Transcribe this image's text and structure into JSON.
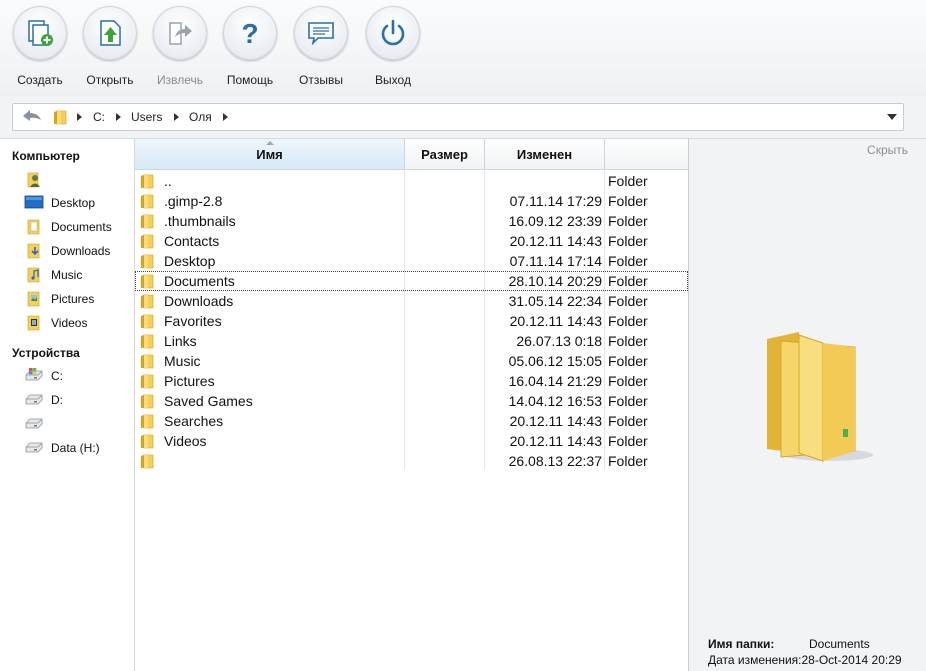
{
  "toolbar": {
    "create": "Создать",
    "open": "Открыть",
    "extract": "Извлечь",
    "help": "Помощь",
    "feedback": "Отзывы",
    "exit": "Выход"
  },
  "address": {
    "crumbs": [
      "C:",
      "Users",
      "Оля"
    ]
  },
  "sidebar": {
    "computer_title": "Компьютер",
    "computer_items": [
      "",
      "Desktop",
      "Documents",
      "Downloads",
      "Music",
      "Pictures",
      "Videos"
    ],
    "devices_title": "Устройства",
    "device_items": [
      "C:",
      "D:",
      "",
      "Data (H:)"
    ]
  },
  "list": {
    "headers": {
      "name": "Имя",
      "size": "Размер",
      "modified": "Изменен",
      "type": ""
    },
    "rows": [
      {
        "name": "..",
        "size": "",
        "modified": "",
        "type": "Folder"
      },
      {
        "name": ".gimp-2.8",
        "size": "",
        "modified": "07.11.14 17:29",
        "type": "Folder"
      },
      {
        "name": ".thumbnails",
        "size": "",
        "modified": "16.09.12 23:39",
        "type": "Folder"
      },
      {
        "name": "Contacts",
        "size": "",
        "modified": "20.12.11 14:43",
        "type": "Folder"
      },
      {
        "name": "Desktop",
        "size": "",
        "modified": "07.11.14 17:14",
        "type": "Folder"
      },
      {
        "name": "Documents",
        "size": "",
        "modified": "28.10.14 20:29",
        "type": "Folder"
      },
      {
        "name": "Downloads",
        "size": "",
        "modified": "31.05.14 22:34",
        "type": "Folder"
      },
      {
        "name": "Favorites",
        "size": "",
        "modified": "20.12.11 14:43",
        "type": "Folder"
      },
      {
        "name": "Links",
        "size": "",
        "modified": "26.07.13 0:18",
        "type": "Folder"
      },
      {
        "name": "Music",
        "size": "",
        "modified": "05.06.12 15:05",
        "type": "Folder"
      },
      {
        "name": "Pictures",
        "size": "",
        "modified": "16.04.14 21:29",
        "type": "Folder"
      },
      {
        "name": "Saved Games",
        "size": "",
        "modified": "14.04.12 16:53",
        "type": "Folder"
      },
      {
        "name": "Searches",
        "size": "",
        "modified": "20.12.11 14:43",
        "type": "Folder"
      },
      {
        "name": "Videos",
        "size": "",
        "modified": "20.12.11 14:43",
        "type": "Folder"
      },
      {
        "name": "",
        "size": "",
        "modified": "26.08.13 22:37",
        "type": "Folder"
      }
    ]
  },
  "preview": {
    "hide": "Скрыть",
    "folder_label": "Имя папки:",
    "folder_value": "Documents",
    "date_label": "Дата изменения:",
    "date_value": "28-Oct-2014 20:29"
  },
  "colors": {
    "accent": "#2a8fd0",
    "folder": "#f2c94c",
    "selection_header": "#d6e9f7"
  }
}
